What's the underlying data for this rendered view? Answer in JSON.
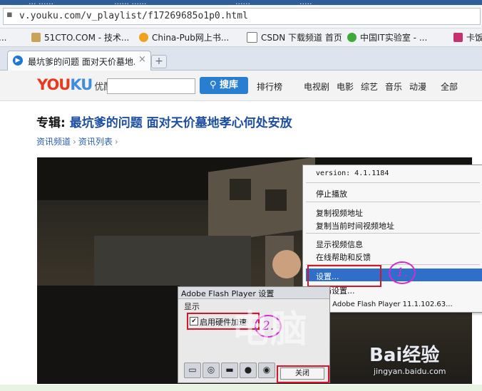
{
  "browser": {
    "top_strip_text": [
      "... ......",
      "...... ......",
      "......",
      "....."
    ],
    "address": {
      "url": "v.youku.com/v_playlist/f17269685o1p0.html"
    },
    "bookmarks": [
      {
        "label": "...",
        "icon": "bookmark-icon"
      },
      {
        "label": "51CTO.COM - 技术...",
        "icon": "scissors-icon"
      },
      {
        "label": "China-Pub网上书...",
        "icon": "lightning-icon"
      },
      {
        "label": "CSDN 下载频道 首页",
        "icon": "page-icon"
      },
      {
        "label": "中国IT实验室 - ...",
        "icon": "leaf-icon"
      },
      {
        "label": "卡饭",
        "icon": "kafan-icon"
      }
    ],
    "tab": {
      "label": "最坑爹的问题 面对天价墓地...",
      "close": "×",
      "new_tab": "+"
    }
  },
  "youku": {
    "logo": {
      "you": "YOU",
      "ku": "KU",
      "cn": "优酷"
    },
    "search_button": "搜库",
    "nav": [
      "排行榜",
      "电视剧",
      "电影",
      "综艺",
      "音乐",
      "动漫",
      "全部"
    ],
    "page_title_prefix": "专辑:",
    "page_title": "最坑爹的问题 面对天价墓地孝心何处安放",
    "breadcrumb": [
      "资讯频道",
      "资讯列表"
    ]
  },
  "context_menu": {
    "items": [
      "version: 4.1.1184",
      "停止播放",
      "复制视频地址",
      "复制当前时间视频地址",
      "显示视频信息",
      "在线帮助和反馈",
      "设置...",
      "全局设置...",
      "关于 Adobe Flash Player 11.1.102.63..."
    ]
  },
  "flash_dialog": {
    "title": "Adobe Flash Player 设置",
    "section": "显示",
    "checkbox_label": "启用硬件加速",
    "checkbox_mark": "✔",
    "close_button": "关闭",
    "tabs": [
      "monitor-icon",
      "camera-icon",
      "folder-icon",
      "microphone-icon",
      "webcam-icon"
    ]
  },
  "annotations": {
    "marker_1": "1.",
    "marker_2": "2."
  },
  "watermarks": {
    "pc": "电脑",
    "baidu_logo": "Bai经验",
    "baidu_url": "jingyan.baidu.com"
  }
}
